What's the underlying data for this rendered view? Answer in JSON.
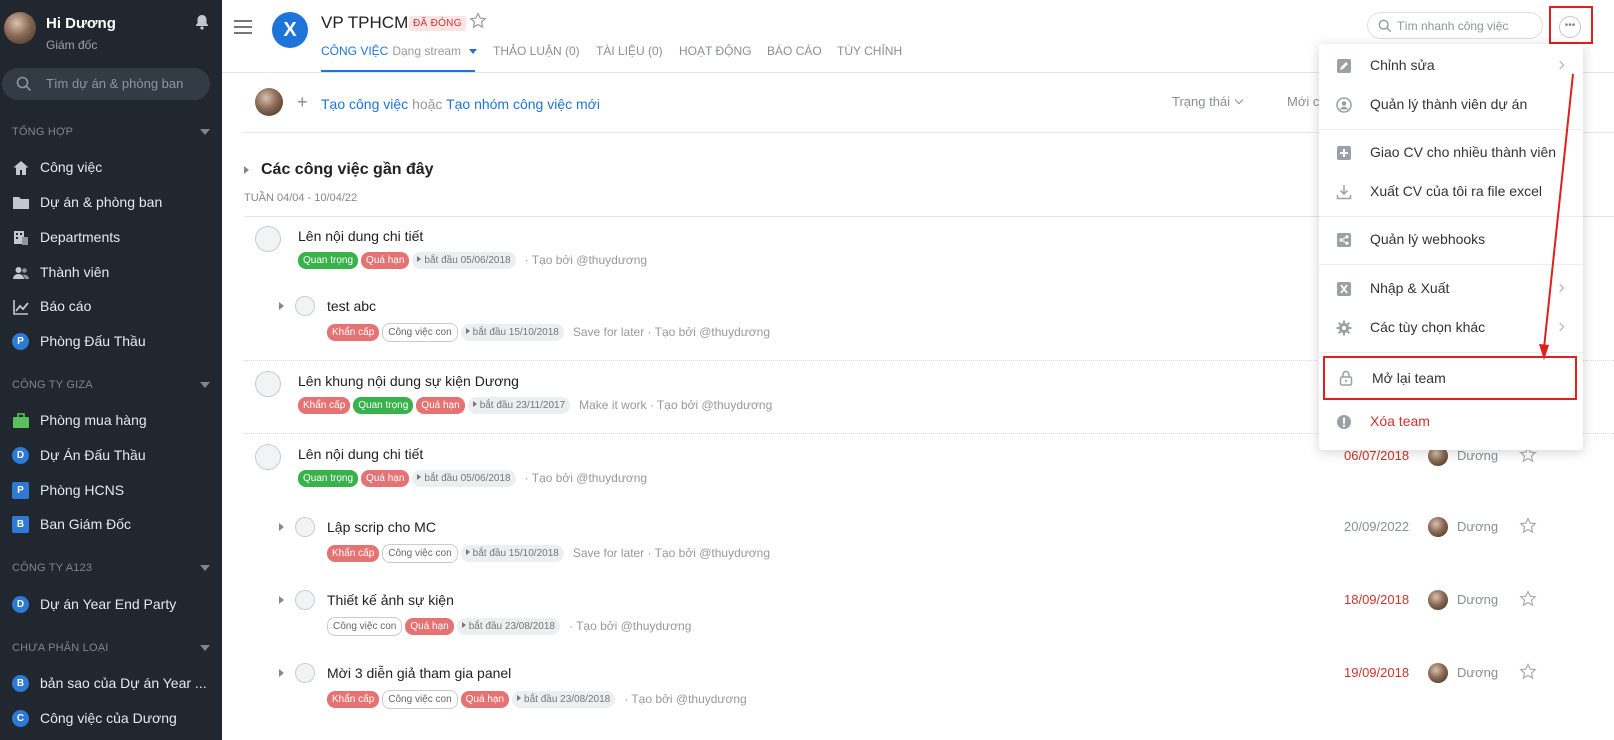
{
  "sidebar": {
    "user_name": "Hi Dương",
    "user_role": "Giám đốc",
    "search_placeholder": "Tìm dự án & phòng ban",
    "sections": [
      {
        "title": "Tổng hợp"
      },
      {
        "title": "Công ty Giza"
      },
      {
        "title": "Công ty A123"
      },
      {
        "title": "Chưa phân loại"
      }
    ],
    "items": [
      {
        "label": "Công việc",
        "icon": "home-icon"
      },
      {
        "label": "Dự án & phòng ban",
        "icon": "folder-icon"
      },
      {
        "label": "Departments",
        "icon": "departments-icon"
      },
      {
        "label": "Thành viên",
        "icon": "members-icon"
      },
      {
        "label": "Báo cáo",
        "icon": "chart-icon"
      },
      {
        "label": "Phòng Đấu Thầu",
        "icon": "letter-badge-icon",
        "letter": "P"
      },
      {
        "label": "Phòng mua hàng",
        "icon": "briefcase-icon"
      },
      {
        "label": "Dự Án Đấu Thầu",
        "icon": "letter-badge-icon",
        "letter": "D"
      },
      {
        "label": "Phòng HCNS",
        "icon": "letter-badge-icon",
        "letter": "P"
      },
      {
        "label": "Ban Giám Đốc",
        "icon": "letter-badge-icon",
        "letter": "B"
      },
      {
        "label": "Dự án Year End Party",
        "icon": "letter-badge-icon",
        "letter": "D"
      },
      {
        "label": "bản sao của Dự án Year ...",
        "icon": "letter-badge-icon",
        "letter": "B"
      },
      {
        "label": "Công việc của Dương",
        "icon": "letter-badge-icon",
        "letter": "C"
      }
    ]
  },
  "header": {
    "project_logo": "X",
    "project_title": "VP TPHCM",
    "status_badge": "ĐÃ ĐÓNG",
    "tabs": [
      {
        "label": "CÔNG VIỆC",
        "sub": "Dạng stream"
      },
      {
        "label": "THẢO LUẬN (0)"
      },
      {
        "label": "TÀI LIỆU (0)"
      },
      {
        "label": "HOẠT ĐỘNG"
      },
      {
        "label": "BÁO CÁO"
      },
      {
        "label": "TÙY CHỈNH"
      }
    ],
    "quick_search_placeholder": "Tìm nhanh công việc",
    "more_label": "•••"
  },
  "toolbar": {
    "plus": "+",
    "create_task": "Tạo công việc",
    "or": "hoặc",
    "create_group": "Tạo nhóm công việc mới",
    "filter_status": "Trạng thái",
    "filter_new": "Mới c"
  },
  "group": {
    "title": "Các công việc gần đây",
    "week": "Tuần 04/04 - 10/04/22"
  },
  "tasks": [
    {
      "title": "Lên nội dung chi tiết",
      "tags": [
        {
          "t": "Quan trọng",
          "c": "green"
        },
        {
          "t": "Quá hạn",
          "c": "red"
        }
      ],
      "start": "bắt đầu 05/06/2018",
      "note": "· Tạo bởi @thuydương"
    },
    {
      "title": "test abc",
      "tags": [
        {
          "t": "Khẩn cấp",
          "c": "red"
        },
        {
          "t": "Công việc con",
          "c": "outline"
        }
      ],
      "start": "bắt đầu 15/10/2018",
      "note": "Save for later · Tạo bởi @thuydương"
    },
    {
      "title": "Lên khung nội dung sự kiện Dương",
      "tags": [
        {
          "t": "Khẩn cấp",
          "c": "red"
        },
        {
          "t": "Quan trọng",
          "c": "green"
        },
        {
          "t": "Quá hạn",
          "c": "red"
        }
      ],
      "start": "bắt đầu 23/11/2017",
      "note": "Make it work · Tạo bởi @thuydương"
    },
    {
      "title": "Lên nội dung chi tiết",
      "tags": [
        {
          "t": "Quan trọng",
          "c": "green"
        },
        {
          "t": "Quá hạn",
          "c": "red"
        }
      ],
      "start": "bắt đầu 05/06/2018",
      "note": "· Tạo bởi @thuydương",
      "due": "06/07/2018",
      "assignee": "Dương"
    },
    {
      "title": "Lập scrip cho MC",
      "tags": [
        {
          "t": "Khẩn cấp",
          "c": "red"
        },
        {
          "t": "Công việc con",
          "c": "outline"
        }
      ],
      "start": "bắt đầu 15/10/2018",
      "note": "Save for later · Tạo bởi @thuydương",
      "due": "20/09/2022",
      "assignee": "Dương"
    },
    {
      "title": "Thiết kế ảnh sự kiện",
      "tags": [
        {
          "t": "Công việc con",
          "c": "outline"
        },
        {
          "t": "Quá hạn",
          "c": "red"
        }
      ],
      "start": "bắt đầu 23/08/2018",
      "note": "· Tạo bởi @thuydương",
      "due": "18/09/2018",
      "assignee": "Dương"
    },
    {
      "title": "Mời 3 diễn giả tham gia panel",
      "tags": [
        {
          "t": "Khẩn cấp",
          "c": "red"
        },
        {
          "t": "Công việc con",
          "c": "outline"
        },
        {
          "t": "Quá hạn",
          "c": "red"
        }
      ],
      "start": "bắt đầu 23/08/2018",
      "note": "· Tạo bởi @thuydương",
      "due": "19/09/2018",
      "assignee": "Dương"
    }
  ],
  "menu": {
    "items": [
      {
        "label": "Chỉnh sửa",
        "icon": "edit-icon",
        "submenu": true
      },
      {
        "label": "Quản lý thành viên dự án",
        "icon": "user-circle-icon"
      },
      {
        "label": "Giao CV cho nhiều thành viên",
        "icon": "plus-square-icon"
      },
      {
        "label": "Xuất CV của tôi ra file excel",
        "icon": "download-icon"
      },
      {
        "label": "Quản lý webhooks",
        "icon": "share-icon"
      },
      {
        "label": "Nhập & Xuất",
        "icon": "excel-icon",
        "submenu": true
      },
      {
        "label": "Các tùy chọn khác",
        "icon": "gear-icon",
        "submenu": true
      },
      {
        "label": "Mở lại team",
        "icon": "lock-open-icon",
        "highlighted": true
      },
      {
        "label": "Xóa team",
        "icon": "alert-icon",
        "danger": true
      }
    ]
  },
  "colors": {
    "sidebar_bg": "#20272f",
    "accent": "#1e74d9",
    "danger": "#d2322d",
    "tag_green": "#38b24a",
    "tag_red": "#e57373",
    "annotation_red": "#e0201c"
  }
}
